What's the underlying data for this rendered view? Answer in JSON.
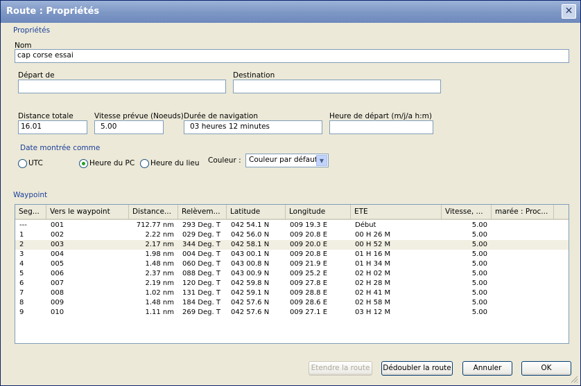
{
  "window": {
    "title": "Route : Propriétés"
  },
  "properties": {
    "section_label": "Propriétés",
    "name_label": "Nom",
    "name_value": "cap corse essai",
    "departure_label": "Départ de",
    "departure_value": "",
    "destination_label": "Destination",
    "destination_value": "",
    "total_distance_label": "Distance totale",
    "total_distance_value": "16.01",
    "planned_speed_label": "Vitesse prévue (Noeuds)",
    "planned_speed_value": "5.00",
    "duration_label": "Durée de navigation",
    "duration_value": "03 heures  12 minutes",
    "departure_time_label": "Heure de départ (m/j/a h:m)",
    "departure_time_value": "",
    "date_shown_label": "Date montrée comme",
    "radio_utc": "UTC",
    "radio_pc": "Heure du PC",
    "radio_local": "Heure du lieu",
    "selected_radio": "pc",
    "color_label": "Couleur :",
    "color_value": "Couleur par défaut"
  },
  "waypoint": {
    "section_label": "Waypoint",
    "columns": [
      "Seg...",
      "Vers le waypoint",
      "Distance...",
      "Relèvem...",
      "Latitude",
      "Longitude",
      "ETE",
      "Vitesse, ...",
      "marée : Proc..."
    ],
    "rows": [
      [
        "---",
        "001",
        "712.77 nm",
        "293 Deg. T",
        "042 54.1 N",
        "009 19.3 E",
        "Début",
        "5.00",
        ""
      ],
      [
        "1",
        "002",
        "2.22 nm",
        "029 Deg. T",
        "042 56.0 N",
        "009 20.8 E",
        "00 H  26 M",
        "5.00",
        ""
      ],
      [
        "2",
        "003",
        "2.17 nm",
        "344 Deg. T",
        "042 58.1 N",
        "009 20.0 E",
        "00 H  52 M",
        "5.00",
        ""
      ],
      [
        "3",
        "004",
        "1.98 nm",
        "004 Deg. T",
        "043 00.1 N",
        "009 20.8 E",
        "01 H  16 M",
        "5.00",
        ""
      ],
      [
        "4",
        "005",
        "1.48 nm",
        "060 Deg. T",
        "043 00.8 N",
        "009 21.9 E",
        "01 H  34 M",
        "5.00",
        ""
      ],
      [
        "5",
        "006",
        "2.37 nm",
        "088 Deg. T",
        "043 00.9 N",
        "009 25.2 E",
        "02 H  02 M",
        "5.00",
        ""
      ],
      [
        "6",
        "007",
        "2.19 nm",
        "120 Deg. T",
        "042 59.8 N",
        "009 27.8 E",
        "02 H  28 M",
        "5.00",
        ""
      ],
      [
        "7",
        "008",
        "1.02 nm",
        "131 Deg. T",
        "042 59.1 N",
        "009 28.8 E",
        "02 H  41 M",
        "5.00",
        ""
      ],
      [
        "8",
        "009",
        "1.48 nm",
        "184 Deg. T",
        "042 57.6 N",
        "009 28.6 E",
        "02 H  58 M",
        "5.00",
        ""
      ],
      [
        "9",
        "010",
        "1.11 nm",
        "269 Deg. T",
        "042 57.6 N",
        "009 27.1 E",
        "03 H  12 M",
        "5.00",
        ""
      ]
    ],
    "selected_row": 2
  },
  "buttons": {
    "extend": "Etendre la route",
    "duplicate": "Dédoubler la route",
    "cancel": "Annuler",
    "ok": "OK"
  },
  "icons": {
    "close": "close-icon",
    "dropdown": "chevron-down-icon",
    "resize": "resize-grip-icon"
  },
  "colors": {
    "title_bar": "#7f99c6",
    "section_label": "#1a3f9a",
    "input_border": "#7f9db9",
    "button_border": "#003c74"
  }
}
